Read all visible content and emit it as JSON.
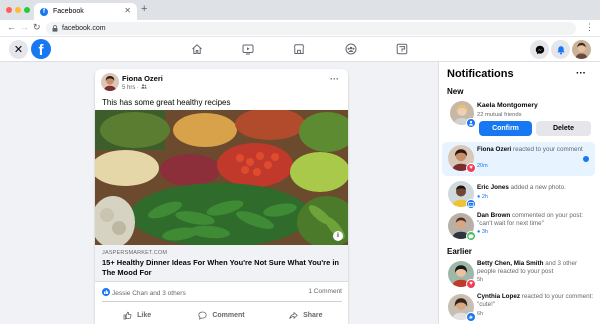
{
  "browser": {
    "tab_title": "Facebook",
    "tab_favicon_letter": "f",
    "url": "facebook.com"
  },
  "post": {
    "author": "Fiona Ozeri",
    "time": "5 hrs",
    "text": "This has some great healthy recipes",
    "link_domain": "JASPERSMARKET.COM",
    "link_title": "15+ Healthy Dinner Ideas For When You're Not Sure What You're in The Mood For",
    "reactions_text": "Jessie Chan and 3 others",
    "comments_count": "1 Comment",
    "actions": {
      "like": "Like",
      "comment": "Comment",
      "share": "Share"
    }
  },
  "notifications": {
    "title": "Notifications",
    "section_new": "New",
    "section_earlier": "Earlier",
    "friend_request": {
      "name": "Kaela Montgomery",
      "mutual": "22 mutual friends",
      "confirm": "Confirm",
      "delete": "Delete"
    },
    "items": [
      {
        "name": "Fiona Ozeri",
        "text": " reacted to your comment",
        "time": "20m"
      },
      {
        "name": "Eric Jones",
        "text": " added a new photo.",
        "time": "2h"
      },
      {
        "name": "Dan Brown",
        "text": " commented on your post: \"can't wait for next time\"",
        "time": "3h"
      }
    ],
    "earlier_items": [
      {
        "name": "Betty Chen, Mia Smith",
        "text": " and 3 other people reacted to your post",
        "time": "5h"
      },
      {
        "name": "Cynthia Lopez",
        "text": " reacted to your comment: \"cute!\"",
        "time": "6h"
      }
    ]
  },
  "colors": {
    "brand": "#1877f2",
    "highlight": "#e7f3ff",
    "love": "#f33e58",
    "comment_green": "#45bd62"
  }
}
